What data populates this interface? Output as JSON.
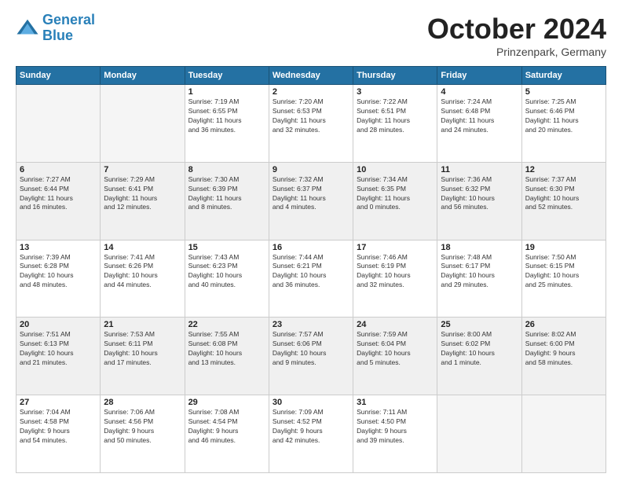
{
  "header": {
    "logo_line1": "General",
    "logo_line2": "Blue",
    "month": "October 2024",
    "location": "Prinzenpark, Germany"
  },
  "weekdays": [
    "Sunday",
    "Monday",
    "Tuesday",
    "Wednesday",
    "Thursday",
    "Friday",
    "Saturday"
  ],
  "weeks": [
    [
      {
        "day": "",
        "detail": ""
      },
      {
        "day": "",
        "detail": ""
      },
      {
        "day": "1",
        "detail": "Sunrise: 7:19 AM\nSunset: 6:55 PM\nDaylight: 11 hours\nand 36 minutes."
      },
      {
        "day": "2",
        "detail": "Sunrise: 7:20 AM\nSunset: 6:53 PM\nDaylight: 11 hours\nand 32 minutes."
      },
      {
        "day": "3",
        "detail": "Sunrise: 7:22 AM\nSunset: 6:51 PM\nDaylight: 11 hours\nand 28 minutes."
      },
      {
        "day": "4",
        "detail": "Sunrise: 7:24 AM\nSunset: 6:48 PM\nDaylight: 11 hours\nand 24 minutes."
      },
      {
        "day": "5",
        "detail": "Sunrise: 7:25 AM\nSunset: 6:46 PM\nDaylight: 11 hours\nand 20 minutes."
      }
    ],
    [
      {
        "day": "6",
        "detail": "Sunrise: 7:27 AM\nSunset: 6:44 PM\nDaylight: 11 hours\nand 16 minutes."
      },
      {
        "day": "7",
        "detail": "Sunrise: 7:29 AM\nSunset: 6:41 PM\nDaylight: 11 hours\nand 12 minutes."
      },
      {
        "day": "8",
        "detail": "Sunrise: 7:30 AM\nSunset: 6:39 PM\nDaylight: 11 hours\nand 8 minutes."
      },
      {
        "day": "9",
        "detail": "Sunrise: 7:32 AM\nSunset: 6:37 PM\nDaylight: 11 hours\nand 4 minutes."
      },
      {
        "day": "10",
        "detail": "Sunrise: 7:34 AM\nSunset: 6:35 PM\nDaylight: 11 hours\nand 0 minutes."
      },
      {
        "day": "11",
        "detail": "Sunrise: 7:36 AM\nSunset: 6:32 PM\nDaylight: 10 hours\nand 56 minutes."
      },
      {
        "day": "12",
        "detail": "Sunrise: 7:37 AM\nSunset: 6:30 PM\nDaylight: 10 hours\nand 52 minutes."
      }
    ],
    [
      {
        "day": "13",
        "detail": "Sunrise: 7:39 AM\nSunset: 6:28 PM\nDaylight: 10 hours\nand 48 minutes."
      },
      {
        "day": "14",
        "detail": "Sunrise: 7:41 AM\nSunset: 6:26 PM\nDaylight: 10 hours\nand 44 minutes."
      },
      {
        "day": "15",
        "detail": "Sunrise: 7:43 AM\nSunset: 6:23 PM\nDaylight: 10 hours\nand 40 minutes."
      },
      {
        "day": "16",
        "detail": "Sunrise: 7:44 AM\nSunset: 6:21 PM\nDaylight: 10 hours\nand 36 minutes."
      },
      {
        "day": "17",
        "detail": "Sunrise: 7:46 AM\nSunset: 6:19 PM\nDaylight: 10 hours\nand 32 minutes."
      },
      {
        "day": "18",
        "detail": "Sunrise: 7:48 AM\nSunset: 6:17 PM\nDaylight: 10 hours\nand 29 minutes."
      },
      {
        "day": "19",
        "detail": "Sunrise: 7:50 AM\nSunset: 6:15 PM\nDaylight: 10 hours\nand 25 minutes."
      }
    ],
    [
      {
        "day": "20",
        "detail": "Sunrise: 7:51 AM\nSunset: 6:13 PM\nDaylight: 10 hours\nand 21 minutes."
      },
      {
        "day": "21",
        "detail": "Sunrise: 7:53 AM\nSunset: 6:11 PM\nDaylight: 10 hours\nand 17 minutes."
      },
      {
        "day": "22",
        "detail": "Sunrise: 7:55 AM\nSunset: 6:08 PM\nDaylight: 10 hours\nand 13 minutes."
      },
      {
        "day": "23",
        "detail": "Sunrise: 7:57 AM\nSunset: 6:06 PM\nDaylight: 10 hours\nand 9 minutes."
      },
      {
        "day": "24",
        "detail": "Sunrise: 7:59 AM\nSunset: 6:04 PM\nDaylight: 10 hours\nand 5 minutes."
      },
      {
        "day": "25",
        "detail": "Sunrise: 8:00 AM\nSunset: 6:02 PM\nDaylight: 10 hours\nand 1 minute."
      },
      {
        "day": "26",
        "detail": "Sunrise: 8:02 AM\nSunset: 6:00 PM\nDaylight: 9 hours\nand 58 minutes."
      }
    ],
    [
      {
        "day": "27",
        "detail": "Sunrise: 7:04 AM\nSunset: 4:58 PM\nDaylight: 9 hours\nand 54 minutes."
      },
      {
        "day": "28",
        "detail": "Sunrise: 7:06 AM\nSunset: 4:56 PM\nDaylight: 9 hours\nand 50 minutes."
      },
      {
        "day": "29",
        "detail": "Sunrise: 7:08 AM\nSunset: 4:54 PM\nDaylight: 9 hours\nand 46 minutes."
      },
      {
        "day": "30",
        "detail": "Sunrise: 7:09 AM\nSunset: 4:52 PM\nDaylight: 9 hours\nand 42 minutes."
      },
      {
        "day": "31",
        "detail": "Sunrise: 7:11 AM\nSunset: 4:50 PM\nDaylight: 9 hours\nand 39 minutes."
      },
      {
        "day": "",
        "detail": ""
      },
      {
        "day": "",
        "detail": ""
      }
    ]
  ]
}
